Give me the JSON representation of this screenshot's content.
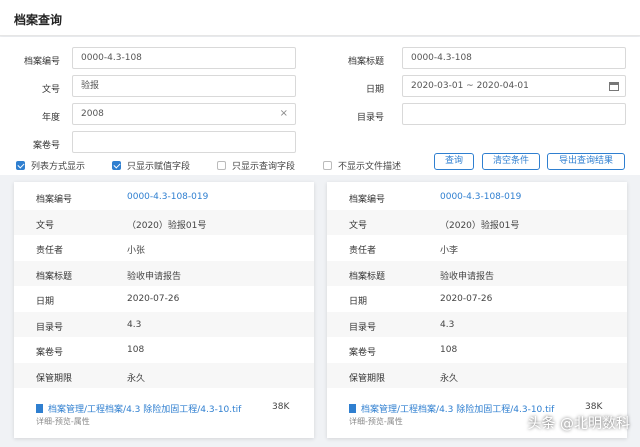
{
  "header": {
    "title": "档案查询"
  },
  "form": {
    "archive_no_label": "档案编号",
    "archive_no_value": "0000-4.3-108",
    "doc_no_label": "文号",
    "doc_no_value": "验报",
    "year_label": "年度",
    "year_value": "2008",
    "year_clear": "×",
    "volume_no_label": "案卷号",
    "volume_no_value": "",
    "archive_title_label": "档案标题",
    "archive_title_value": "0000-4.3-108",
    "date_label": "日期",
    "date_value": "2020-03-01 ~ 2020-04-01",
    "catalog_no_label": "目录号",
    "catalog_no_value": ""
  },
  "options": [
    {
      "label": "列表方式显示",
      "checked": true
    },
    {
      "label": "只显示赋值字段",
      "checked": true
    },
    {
      "label": "只显示查询字段",
      "checked": false
    },
    {
      "label": "不显示文件描述",
      "checked": false
    }
  ],
  "buttons": {
    "query": "查询",
    "clear": "清空条件",
    "export": "导出查询结果"
  },
  "results": [
    {
      "fields": [
        {
          "key": "档案编号",
          "value": "0000-4.3-108-019"
        },
        {
          "key": "文号",
          "value": "（2020）验报01号"
        },
        {
          "key": "责任者",
          "value": "小张"
        },
        {
          "key": "档案标题",
          "value": "验收申请报告"
        },
        {
          "key": "日期",
          "value": "2020-07-26"
        },
        {
          "key": "目录号",
          "value": "4.3"
        },
        {
          "key": "案卷号",
          "value": "108"
        },
        {
          "key": "保管期限",
          "value": "永久"
        }
      ],
      "file_path": "档案管理/工程档案/4.3 除险加固工程/4.3-10.tif",
      "file_size": "38K",
      "file_meta": "详细-预览-属性"
    },
    {
      "fields": [
        {
          "key": "档案编号",
          "value": "0000-4.3-108-019"
        },
        {
          "key": "文号",
          "value": "（2020）验报01号"
        },
        {
          "key": "责任者",
          "value": "小李"
        },
        {
          "key": "档案标题",
          "value": "验收申请报告"
        },
        {
          "key": "日期",
          "value": "2020-07-26"
        },
        {
          "key": "目录号",
          "value": "4.3"
        },
        {
          "key": "案卷号",
          "value": "108"
        },
        {
          "key": "保管期限",
          "value": "永久"
        }
      ],
      "file_path": "档案管理/工程档案/4.3 除险加固工程/4.3-10.tif",
      "file_size": "38K",
      "file_meta": "详细-预览-属性"
    }
  ],
  "watermark": "头条 @北明数科",
  "colors": {
    "accent": "#2f7fd0"
  }
}
